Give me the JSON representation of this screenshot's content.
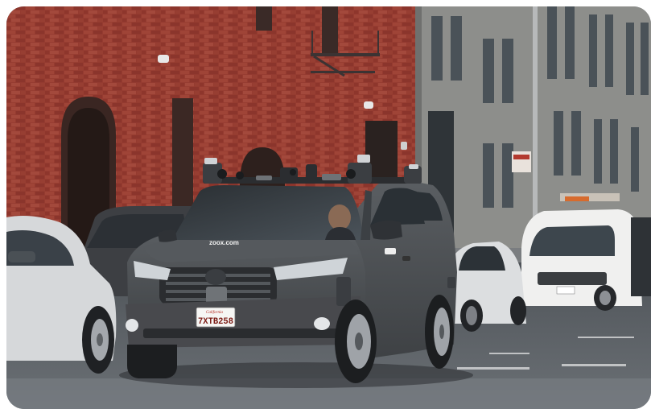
{
  "photo": {
    "license_plate": "7XTB258",
    "plate_state": "California",
    "hood_brand": "zoox.com",
    "colors": {
      "brick": "#9a3d33",
      "stone_building": "#8e8f8c",
      "road": "#5d6166",
      "vehicle_body": "#4a4d50",
      "van": "#f1f1f0",
      "sedan": "#d4d6d8"
    }
  }
}
